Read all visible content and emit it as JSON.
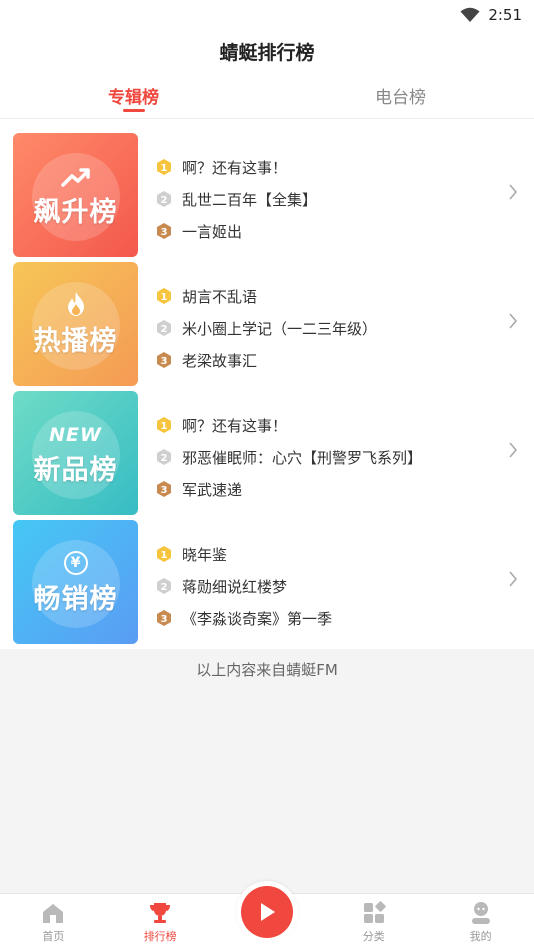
{
  "status_bar": {
    "time": "2:51"
  },
  "title": "蜻蜓排行榜",
  "tabs": [
    {
      "label": "专辑榜",
      "active": true
    },
    {
      "label": "电台榜",
      "active": false
    }
  ],
  "rankings": [
    {
      "cover_title": "飙升榜",
      "icon": "trend-up-icon",
      "items": [
        "啊？还有这事！",
        "乱世二百年【全集】",
        "一言姬出"
      ]
    },
    {
      "cover_title": "热播榜",
      "icon": "flame-icon",
      "items": [
        "胡言不乱语",
        "米小圈上学记（一二三年级）",
        "老梁故事汇"
      ]
    },
    {
      "cover_title": "新品榜",
      "icon": "new-badge-icon",
      "icon_text": "NEW",
      "items": [
        "啊？还有这事！",
        "邪恶催眠师：心穴【刑警罗飞系列】",
        "军武速递"
      ]
    },
    {
      "cover_title": "畅销榜",
      "icon": "yen-coin-icon",
      "icon_text": "¥",
      "items": [
        "晓年鉴",
        "蒋勋细说红楼梦",
        "《李淼谈奇案》第一季"
      ]
    }
  ],
  "footer_note": "以上内容来自蜻蜓FM",
  "bottom_nav": [
    {
      "label": "首页",
      "icon": "home-icon",
      "active": false
    },
    {
      "label": "排行榜",
      "icon": "trophy-icon",
      "active": true
    },
    {
      "label": "",
      "icon": "play-icon",
      "active": false
    },
    {
      "label": "分类",
      "icon": "category-icon",
      "active": false
    },
    {
      "label": "我的",
      "icon": "profile-icon",
      "active": false
    }
  ],
  "colors": {
    "accent": "#f0483e",
    "gold": "#f6c43d",
    "silver": "#cfcfcf",
    "bronze": "#c98a4f"
  }
}
